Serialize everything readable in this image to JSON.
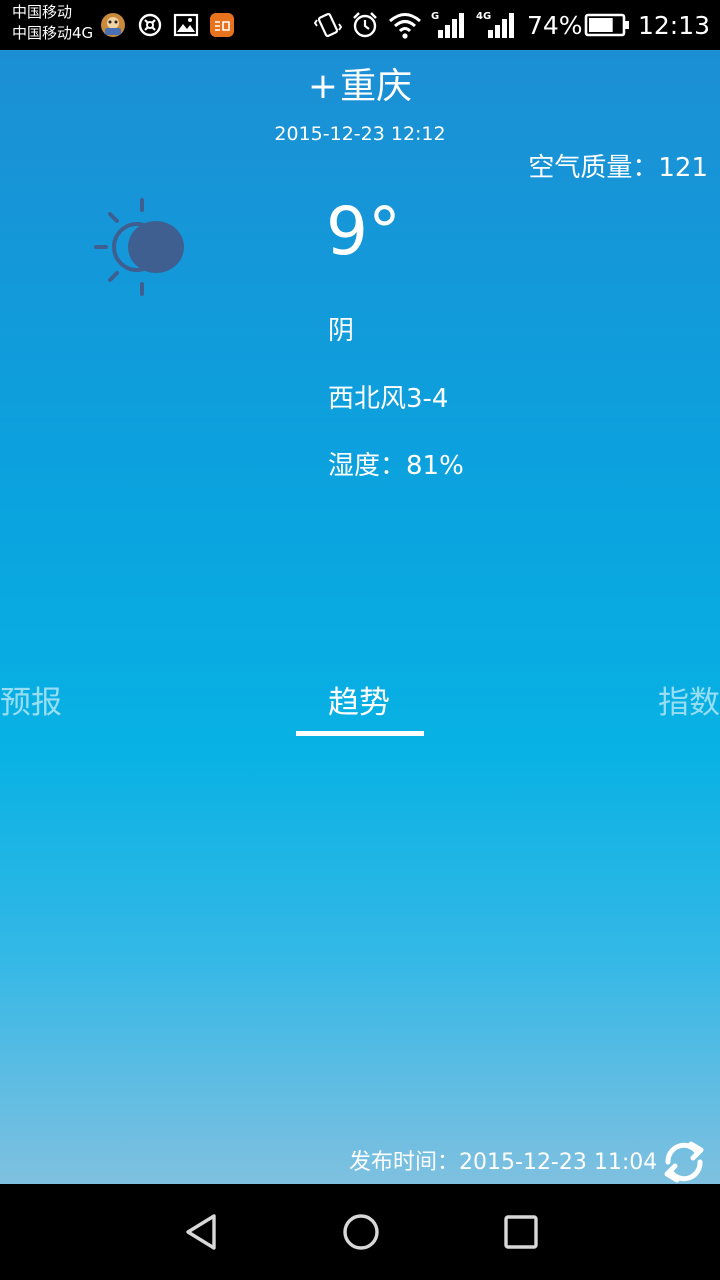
{
  "status_bar": {
    "carrier_1": "中国移动",
    "carrier_2": "中国移动4G",
    "notification_icons": [
      "game-app-icon",
      "cleaner-app-icon",
      "image-icon",
      "365-app-icon"
    ],
    "system_icons": [
      "vibrate-icon",
      "alarm-icon",
      "wifi-icon",
      "signal-g-icon",
      "signal-4g-icon",
      "battery-icon"
    ],
    "signal_labels": {
      "sim1": "G",
      "sim2": "4G"
    },
    "battery_percent": "74%",
    "battery_level": 0.74,
    "time": "12:13"
  },
  "weather": {
    "city_prefix": "+",
    "city": "重庆",
    "date": "2015-12-23  12:12",
    "air_quality_label": "空气质量：",
    "air_quality_value": "121",
    "icon": "overcast-sun-icon",
    "temperature": "9°",
    "condition": "阴",
    "wind": "西北风3-4",
    "humidity": "湿度：81%"
  },
  "tabs": {
    "items": [
      {
        "label": "预报",
        "active": false
      },
      {
        "label": "趋势",
        "active": true
      },
      {
        "label": "指数",
        "active": false
      }
    ]
  },
  "footer": {
    "release_label": "发布时间：",
    "release_time": "2015-12-23 11:04",
    "refresh_icon": "refresh-icon"
  },
  "nav_bar": {
    "icons": [
      "back-icon",
      "home-icon",
      "recents-icon"
    ]
  },
  "colors": {
    "sky_top": "#1c8fd4",
    "sky_mid": "#08b2e4",
    "sky_bottom": "#7fc0e0",
    "weather_icon": "#3e5f90"
  }
}
